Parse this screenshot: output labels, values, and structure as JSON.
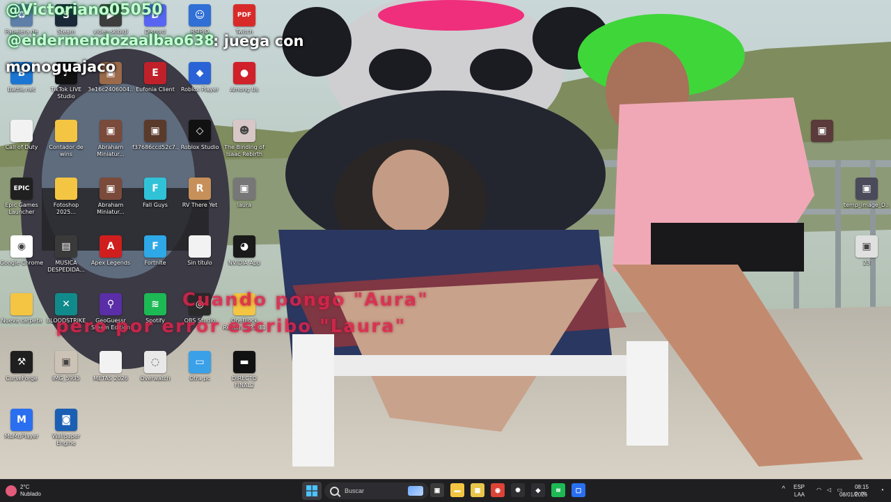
{
  "overlay": {
    "user1": "@Victoriano05050",
    "user2": "@eidermendozaalbao638",
    "play_text": ": juega con",
    "game_text": "monoguajaco",
    "meme_line1": "Cuando pongo \"Aura\"",
    "meme_line2": "pero por error escribo \"Laura\""
  },
  "desktop": {
    "icons": [
      {
        "id": "papelera",
        "label": "Papelera de",
        "icon": "recycle-bin-icon",
        "color": "#5d7fa8",
        "glyph": "♻"
      },
      {
        "id": "steam",
        "label": "Steam",
        "icon": "steam-icon",
        "color": "#1b2838",
        "glyph": "S"
      },
      {
        "id": "video-skibidi",
        "label": "video skibidi",
        "icon": "video-file-icon",
        "color": "#3d3d3d",
        "glyph": "▶"
      },
      {
        "id": "discord",
        "label": "Discord",
        "icon": "discord-icon",
        "color": "#5865f2",
        "glyph": "D"
      },
      {
        "id": "rsipio",
        "label": "RSIPIO",
        "icon": "emoji-folder-icon",
        "color": "#2f6fd6",
        "glyph": "☺"
      },
      {
        "id": "twitch",
        "label": "Twitch",
        "icon": "pdf-file-icon",
        "color": "#d92a2a",
        "glyph": "PDF"
      },
      {
        "id": "battlenet",
        "label": "Battle.net",
        "icon": "battlenet-icon",
        "color": "#1a76d2",
        "glyph": "B"
      },
      {
        "id": "tiktok-live",
        "label": "TikTok LIVE Studio",
        "icon": "tiktok-icon",
        "color": "#111111",
        "glyph": "♪"
      },
      {
        "id": "hash-file",
        "label": "3e16c2406004...",
        "icon": "image-file-icon",
        "color": "#9b6a4a",
        "glyph": "▣"
      },
      {
        "id": "eufonia",
        "label": "Eufonia Client",
        "icon": "eufonia-icon",
        "color": "#c0202a",
        "glyph": "E"
      },
      {
        "id": "roblox-player",
        "label": "Roblox Player",
        "icon": "roblox-icon",
        "color": "#2a63d6",
        "glyph": "◆"
      },
      {
        "id": "among-us",
        "label": "Among Us",
        "icon": "among-us-icon",
        "color": "#d0202a",
        "glyph": "●"
      },
      {
        "id": "call-of-duty",
        "label": "Call of Duty",
        "icon": "blank-file-icon",
        "color": "#f2f2f2",
        "glyph": ""
      },
      {
        "id": "contador-wins",
        "label": "Contador de wins",
        "icon": "folder-icon",
        "color": "#f4c542",
        "glyph": ""
      },
      {
        "id": "abraham1",
        "label": "Abraham Miniatur...",
        "icon": "image-file-icon",
        "color": "#7a4a3a",
        "glyph": "▣"
      },
      {
        "id": "f37686",
        "label": "f37686ccd52c7...",
        "icon": "image-file-icon",
        "color": "#5a3a2a",
        "glyph": "▣"
      },
      {
        "id": "roblox-studio",
        "label": "Roblox Studio",
        "icon": "roblox-studio-icon",
        "color": "#111111",
        "glyph": "◇"
      },
      {
        "id": "isaac",
        "label": "The Binding of Isaac Rebirth",
        "icon": "isaac-icon",
        "color": "#d8c7c7",
        "glyph": "☻"
      },
      {
        "id": "epic",
        "label": "Epic Games Launcher",
        "icon": "epic-games-icon",
        "color": "#202020",
        "glyph": "EPIC"
      },
      {
        "id": "fotoshop",
        "label": "Fotoshop 2025...",
        "icon": "folder-icon",
        "color": "#f4c542",
        "glyph": ""
      },
      {
        "id": "abraham2",
        "label": "Abraham Miniatur...",
        "icon": "image-file-icon",
        "color": "#7a4a3a",
        "glyph": "▣"
      },
      {
        "id": "fall-guys",
        "label": "Fall Guys",
        "icon": "fall-guys-icon",
        "color": "#30c3d8",
        "glyph": "F"
      },
      {
        "id": "rv-there-yet",
        "label": "RV There Yet",
        "icon": "rv-icon",
        "color": "#c7905a",
        "glyph": "R"
      },
      {
        "id": "laura",
        "label": "laura",
        "icon": "image-file-icon",
        "color": "#777777",
        "glyph": "▣"
      },
      {
        "id": "chrome",
        "label": "Google Chrome",
        "icon": "chrome-icon",
        "color": "#ffffff",
        "glyph": "◉"
      },
      {
        "id": "musica",
        "label": "MUSICA DESPEDIDA...",
        "icon": "media-folder-icon",
        "color": "#3a3a3a",
        "glyph": "▤"
      },
      {
        "id": "apex",
        "label": "Apex Legends",
        "icon": "apex-icon",
        "color": "#d01e1e",
        "glyph": "A"
      },
      {
        "id": "fortnite",
        "label": "Fortnite",
        "icon": "fortnite-icon",
        "color": "#2ea8e6",
        "glyph": "F"
      },
      {
        "id": "sin-titulo",
        "label": "Sin título",
        "icon": "document-icon",
        "color": "#f2f2f2",
        "glyph": ""
      },
      {
        "id": "nvidia",
        "label": "NVIDIA App",
        "icon": "nvidia-icon",
        "color": "#1a1a1a",
        "glyph": "◕"
      },
      {
        "id": "nueva-carpeta",
        "label": "Nueva carpeta",
        "icon": "folder-icon",
        "color": "#f4c542",
        "glyph": ""
      },
      {
        "id": "bloodstrike",
        "label": "BLOODSTRIKE",
        "icon": "bloodstrike-icon",
        "color": "#108a8a",
        "glyph": "✕"
      },
      {
        "id": "geoguessr",
        "label": "GeoGuessr Steam Edition",
        "icon": "geoguessr-icon",
        "color": "#5a2ea6",
        "glyph": "⚲"
      },
      {
        "id": "spotify",
        "label": "Spotify",
        "icon": "spotify-icon",
        "color": "#1db954",
        "glyph": "≋"
      },
      {
        "id": "obs",
        "label": "OBS Studio",
        "icon": "obs-icon",
        "color": "#2a2a2a",
        "glyph": "◎"
      },
      {
        "id": "oneblock",
        "label": "OneBlock Reborn 1.21.11",
        "icon": "folder-icon",
        "color": "#f4c542",
        "glyph": ""
      },
      {
        "id": "curseforge",
        "label": "CurseForge",
        "icon": "curseforge-icon",
        "color": "#1f1f1f",
        "glyph": "⚒"
      },
      {
        "id": "img5935",
        "label": "IMG_5935",
        "icon": "image-file-icon",
        "color": "#ccc2b5",
        "glyph": "▣"
      },
      {
        "id": "metas",
        "label": "METAS 2026",
        "icon": "document-icon",
        "color": "#f2f2f2",
        "glyph": ""
      },
      {
        "id": "overwatch",
        "label": "Overwatch",
        "icon": "overwatch-icon",
        "color": "#e8e8e8",
        "glyph": "◌"
      },
      {
        "id": "otra-pc",
        "label": "Otra pc",
        "icon": "this-pc-icon",
        "color": "#3aa0e8",
        "glyph": "▭"
      },
      {
        "id": "directo-final",
        "label": "DIRECTO FINAL2",
        "icon": "video-file-icon",
        "color": "#111111",
        "glyph": "▬"
      },
      {
        "id": "mumuplayer",
        "label": "MuMuPlayer",
        "icon": "mumu-icon",
        "color": "#2a6ff0",
        "glyph": "M"
      },
      {
        "id": "wallpaper-engine",
        "label": "Wallpaper Engine",
        "icon": "wallpaper-engine-icon",
        "color": "#1a5fb4",
        "glyph": "◙"
      },
      {
        "id": "right-1",
        "label": "",
        "icon": "image-file-icon",
        "color": "#5a3a3a",
        "glyph": "▣"
      },
      {
        "id": "temp-image",
        "label": "temp_image_D...",
        "icon": "image-file-icon",
        "color": "#4a4a5a",
        "glyph": "▣"
      },
      {
        "id": "right-23",
        "label": "23",
        "icon": "image-file-icon",
        "color": "#e0e0e0",
        "glyph": "▣"
      }
    ]
  },
  "taskbar": {
    "weather_temp": "2°C",
    "weather_desc": "Nublado",
    "search_placeholder": "Buscar",
    "apps": [
      {
        "name": "task-view-icon",
        "color": "#3a3a3a",
        "glyph": "▣"
      },
      {
        "name": "file-explorer-icon",
        "color": "#f4c542",
        "glyph": "▬"
      },
      {
        "name": "store-icon",
        "color": "#e8c64a",
        "glyph": "▦"
      },
      {
        "name": "chrome-icon",
        "color": "#db4437",
        "glyph": "◉"
      },
      {
        "name": "chatgpt-icon",
        "color": "#2f2f33",
        "glyph": "✺"
      },
      {
        "name": "unity-icon",
        "color": "#2f2f33",
        "glyph": "◆"
      },
      {
        "name": "spotify-icon",
        "color": "#1db954",
        "glyph": "≋"
      },
      {
        "name": "app-blue-icon",
        "color": "#2a6ff0",
        "glyph": "▢"
      }
    ],
    "tray": {
      "lang1": "ESP",
      "lang2": "LAA",
      "time": "08:15 p. m.",
      "date": "08/01/2026"
    }
  }
}
